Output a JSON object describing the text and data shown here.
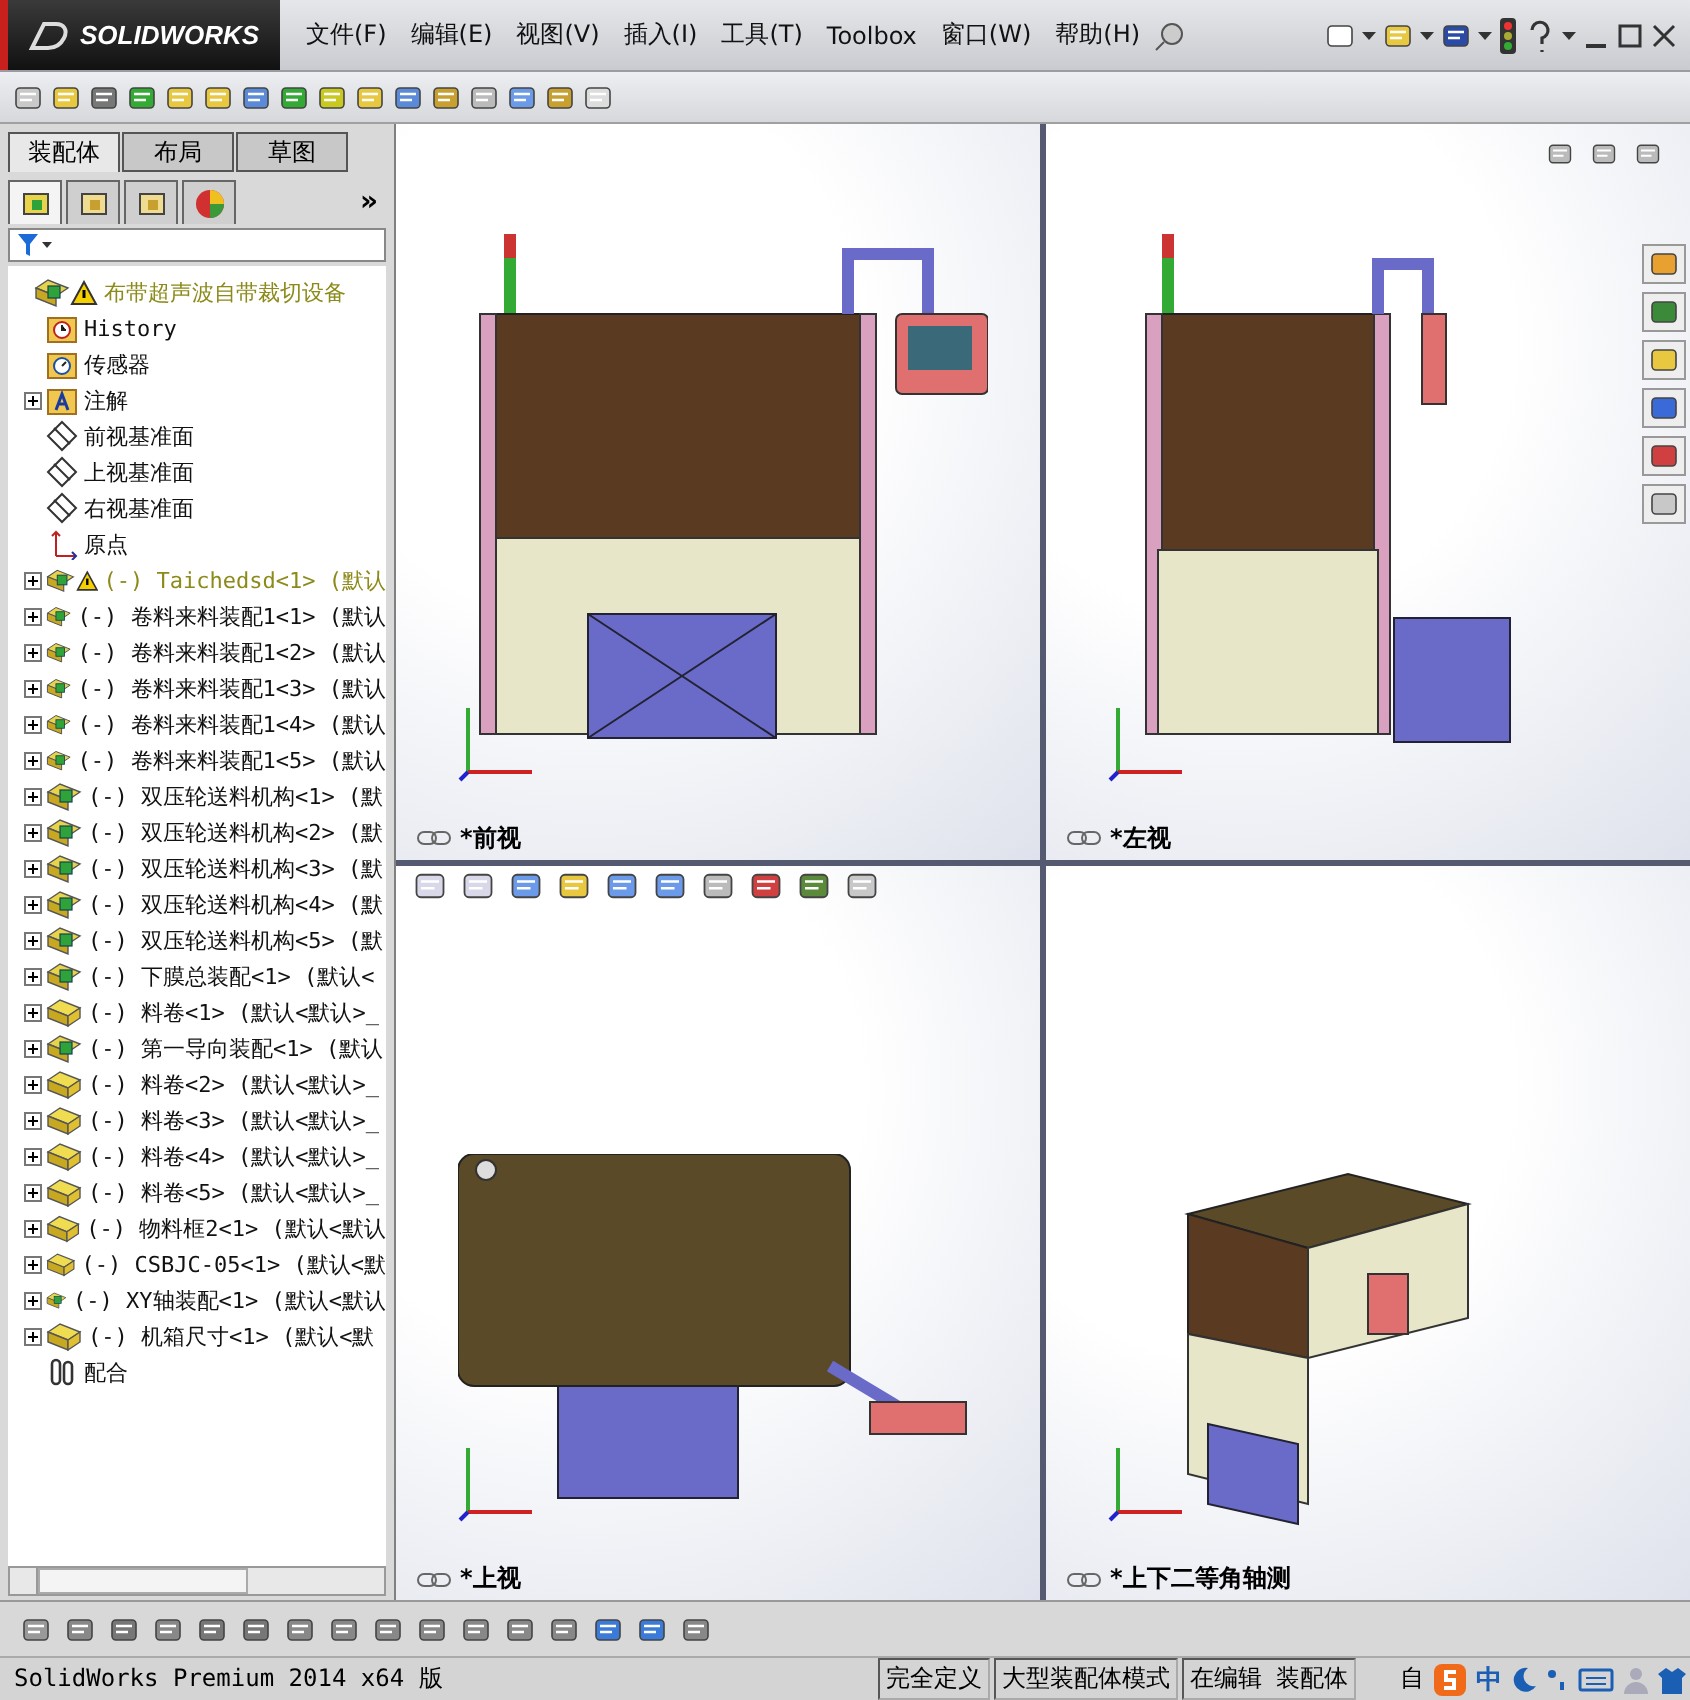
{
  "logo": {
    "text": "SOLIDWORKS"
  },
  "menu": [
    {
      "label": "文件(F)"
    },
    {
      "label": "编辑(E)"
    },
    {
      "label": "视图(V)"
    },
    {
      "label": "插入(I)"
    },
    {
      "label": "工具(T)"
    },
    {
      "label": "Toolbox"
    },
    {
      "label": "窗口(W)"
    },
    {
      "label": "帮助(H)"
    }
  ],
  "panel_tabs": [
    {
      "label": "装配体",
      "selected": true
    },
    {
      "label": "布局",
      "selected": false
    },
    {
      "label": "草图",
      "selected": false
    }
  ],
  "manager_tabs": [
    {
      "kind": "tree",
      "selected": true
    },
    {
      "kind": "property",
      "selected": false
    },
    {
      "kind": "config",
      "selected": false
    },
    {
      "kind": "display",
      "selected": false
    }
  ],
  "manager_more": "»",
  "tree": {
    "label": "布带超声波自带裁切设备",
    "kind": "assembly",
    "warning": true,
    "children": [
      {
        "label": "History",
        "kind": "history"
      },
      {
        "label": "传感器",
        "kind": "sensor"
      },
      {
        "label": "注解",
        "kind": "annotation",
        "expanded": false
      },
      {
        "label": "前视基准面",
        "kind": "plane"
      },
      {
        "label": "上视基准面",
        "kind": "plane"
      },
      {
        "label": "右视基准面",
        "kind": "plane"
      },
      {
        "label": "原点",
        "kind": "origin"
      },
      {
        "label": "(-) Taichedsd<1> (默认",
        "kind": "assembly",
        "warning": true,
        "expanded": false
      },
      {
        "label": "(-) 卷料来料装配1<1> (默认",
        "kind": "assembly",
        "expanded": false
      },
      {
        "label": "(-) 卷料来料装配1<2> (默认",
        "kind": "assembly",
        "expanded": false
      },
      {
        "label": "(-) 卷料来料装配1<3> (默认",
        "kind": "assembly",
        "expanded": false
      },
      {
        "label": "(-) 卷料来料装配1<4> (默认",
        "kind": "assembly",
        "expanded": false
      },
      {
        "label": "(-) 卷料来料装配1<5> (默认",
        "kind": "assembly",
        "expanded": false
      },
      {
        "label": "(-) 双压轮送料机构<1> (默",
        "kind": "assembly",
        "expanded": false
      },
      {
        "label": "(-) 双压轮送料机构<2> (默",
        "kind": "assembly",
        "expanded": false
      },
      {
        "label": "(-) 双压轮送料机构<3> (默",
        "kind": "assembly",
        "expanded": false
      },
      {
        "label": "(-) 双压轮送料机构<4> (默",
        "kind": "assembly",
        "expanded": false
      },
      {
        "label": "(-) 双压轮送料机构<5> (默",
        "kind": "assembly",
        "expanded": false
      },
      {
        "label": "(-) 下膜总装配<1> (默认<",
        "kind": "assembly",
        "expanded": false
      },
      {
        "label": "(-) 料卷<1> (默认<默认>_",
        "kind": "part",
        "expanded": false
      },
      {
        "label": "(-) 第一导向装配<1> (默认",
        "kind": "assembly",
        "expanded": false
      },
      {
        "label": "(-) 料卷<2> (默认<默认>_",
        "kind": "part",
        "expanded": false
      },
      {
        "label": "(-) 料卷<3> (默认<默认>_",
        "kind": "part",
        "expanded": false
      },
      {
        "label": "(-) 料卷<4> (默认<默认>_",
        "kind": "part",
        "expanded": false
      },
      {
        "label": "(-) 料卷<5> (默认<默认>_",
        "kind": "part",
        "expanded": false
      },
      {
        "label": "(-) 物料框2<1> (默认<默认",
        "kind": "part",
        "expanded": false
      },
      {
        "label": "(-) CSBJC-05<1> (默认<默",
        "kind": "part",
        "expanded": false
      },
      {
        "label": "(-) XY轴装配<1> (默认<默认",
        "kind": "assembly",
        "expanded": false
      },
      {
        "label": "(-) 机箱尺寸<1> (默认<默",
        "kind": "part",
        "expanded": false
      },
      {
        "label": "配合",
        "kind": "mates"
      }
    ]
  },
  "viewports": [
    {
      "label": "*前视",
      "kind": "front"
    },
    {
      "label": "*左视",
      "kind": "left"
    },
    {
      "label": "*上视",
      "kind": "top"
    },
    {
      "label": "*上下二等角轴测",
      "kind": "iso"
    }
  ],
  "status_bar": [
    {
      "text": "SolidWorks Premium 2014 x64 版"
    },
    {
      "text": "完全定义"
    },
    {
      "text": "大型装配体模式"
    },
    {
      "text": "在编辑 装配体"
    }
  ],
  "ime": {
    "partial": "自",
    "mode": "中"
  }
}
